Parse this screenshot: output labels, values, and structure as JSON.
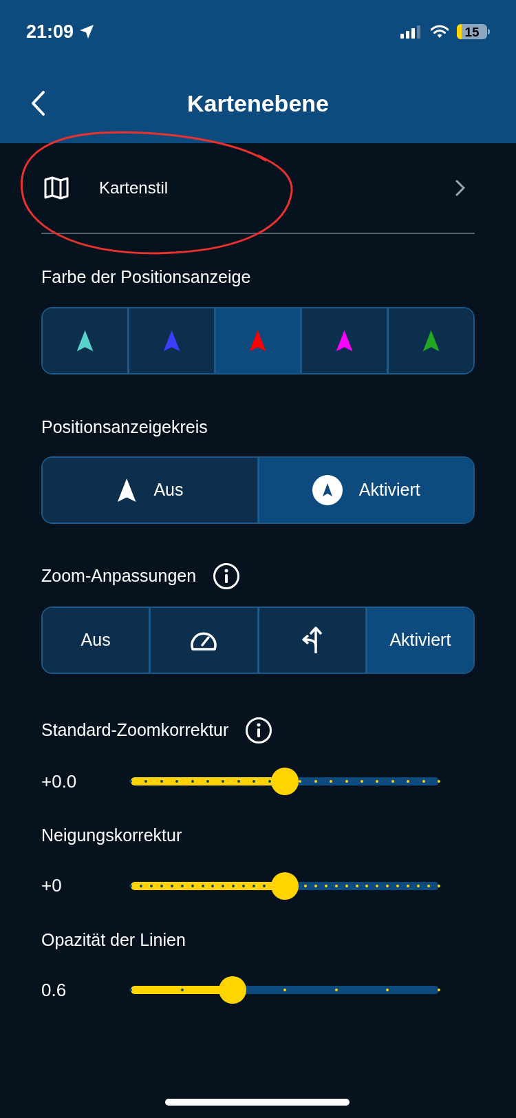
{
  "status_bar": {
    "time": "21:09",
    "battery": "15"
  },
  "header": {
    "title": "Kartenebene"
  },
  "map_style_row": {
    "label": "Kartenstil"
  },
  "position_color": {
    "label": "Farbe der Positionsanzeige",
    "options": [
      {
        "color": "#5ad2cc",
        "selected": false
      },
      {
        "color": "#3d3dff",
        "selected": false
      },
      {
        "color": "#ff0000",
        "selected": true
      },
      {
        "color": "#ff00ff",
        "selected": false
      },
      {
        "color": "#22a822",
        "selected": false
      }
    ]
  },
  "position_circle": {
    "label": "Positionsanzeigekreis",
    "options": [
      {
        "kind": "arrow",
        "label": "Aus",
        "selected": false
      },
      {
        "kind": "circle",
        "label": "Aktiviert",
        "selected": true
      }
    ]
  },
  "zoom_adjust": {
    "label": "Zoom-Anpassungen",
    "options": [
      {
        "kind": "text",
        "label": "Aus",
        "selected": false
      },
      {
        "kind": "speed",
        "selected": false
      },
      {
        "kind": "turn",
        "selected": false
      },
      {
        "kind": "text",
        "label": "Aktiviert",
        "selected": true
      }
    ]
  },
  "sliders": [
    {
      "label": "Standard-Zoomkorrektur",
      "info": true,
      "reading": "+0.0",
      "level": 0.5
    },
    {
      "label": "Neigungskorrektur",
      "info": false,
      "reading": "+0",
      "level": 0.5
    },
    {
      "label": "Opazität der Linien",
      "info": false,
      "reading": "0.6",
      "level": 0.33
    }
  ]
}
